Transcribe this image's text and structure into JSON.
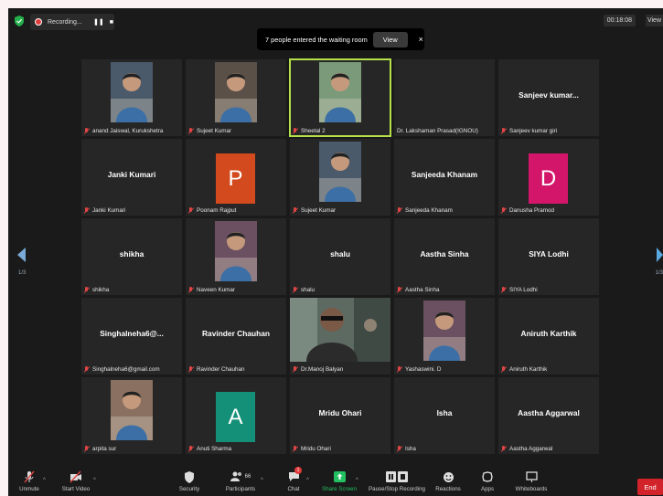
{
  "topbar": {
    "recording_label": "Recording...",
    "pause_label": "❚❚",
    "stop_label": "■",
    "timer": "00:18:08",
    "view_label": "View"
  },
  "banner": {
    "text": "7 people entered the waiting room",
    "view_label": "View",
    "close_label": "×"
  },
  "nav": {
    "left_page": "1/3",
    "right_page": "1/3"
  },
  "tiles": [
    {
      "label": "anand Jaiswal, Kurukshetra",
      "kind": "photo"
    },
    {
      "label": "Sujeet Kumar",
      "kind": "photo"
    },
    {
      "label": "Sheetal 2",
      "kind": "photo",
      "active": true
    },
    {
      "label": "Dr. Lakshaman Prasad(IGNOU)",
      "kind": "empty"
    },
    {
      "name": "Sanjeev  kumar...",
      "label": "Sanjeev kumar giri",
      "kind": "name"
    },
    {
      "name": "Janki Kumari",
      "label": "Janki Kumari",
      "kind": "name"
    },
    {
      "label": "Poonam Rajput",
      "kind": "avatar",
      "letter": "P",
      "color": "#d24a1d"
    },
    {
      "label": "Sujeet Kumar",
      "kind": "photo"
    },
    {
      "name": "Sanjeeda Khanam",
      "label": "Sanjeeda Khanam",
      "kind": "name"
    },
    {
      "label": "Danusha Pramod",
      "kind": "avatar",
      "letter": "D",
      "color": "#d3166a"
    },
    {
      "name": "shikha",
      "label": "shikha",
      "kind": "name"
    },
    {
      "label": "Naveen Kumar",
      "kind": "photo"
    },
    {
      "name": "shalu",
      "label": "shalu",
      "kind": "name"
    },
    {
      "name": "Aastha Sinha",
      "label": "Aastha Sinha",
      "kind": "name"
    },
    {
      "name": "SIYA Lodhi",
      "label": "SIYA Lodhi",
      "kind": "name"
    },
    {
      "name": "Singhalneha6@...",
      "label": "Singhalneha6@gmail.com",
      "kind": "name"
    },
    {
      "name": "Ravinder Chauhan",
      "label": "Ravinder Chauhan",
      "kind": "name"
    },
    {
      "label": "Dr.Manoj Balyan",
      "kind": "video"
    },
    {
      "label": "Yashaswini. D",
      "kind": "photo"
    },
    {
      "name": "Aniruth Karthik",
      "label": "Aniruth Karthik",
      "kind": "name"
    },
    {
      "label": "arpita sur",
      "kind": "photo"
    },
    {
      "label": "Anuti Sharma",
      "kind": "avatar",
      "letter": "A",
      "color": "#159078"
    },
    {
      "name": "Mridu Ohari",
      "label": "Mridu Ohari",
      "kind": "name"
    },
    {
      "name": "Isha",
      "label": "Isha",
      "kind": "name"
    },
    {
      "name": "Aastha Aggarwal",
      "label": "Aastha Aggarwal",
      "kind": "name"
    }
  ],
  "toolbar": {
    "unmute": "Unmute",
    "start_video": "Start Video",
    "security": "Security",
    "participants": "Participants",
    "participants_count": "66",
    "chat": "Chat",
    "chat_badge": "1",
    "share_screen": "Share Screen",
    "pause_recording": "Pause/Stop Recording",
    "reactions": "Reactions",
    "apps": "Apps",
    "whiteboards": "Whiteboards",
    "end": "End"
  },
  "colors": {
    "background": "#1a1a1a",
    "tile": "#262626",
    "active_border": "#b6e04a",
    "end_button": "#d2222a",
    "share_green": "#23c061"
  }
}
